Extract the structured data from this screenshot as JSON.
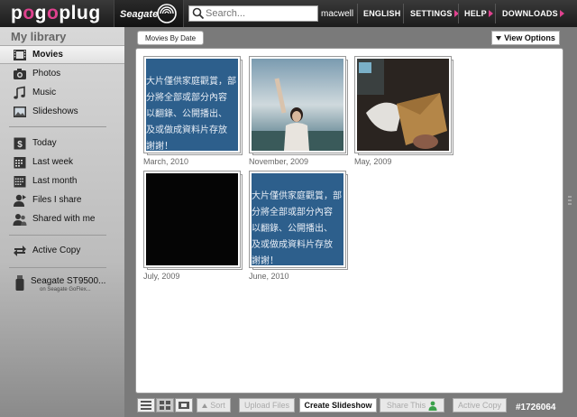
{
  "header": {
    "logo_text": "pogoplug",
    "brand": "Seagate",
    "search_placeholder": "Search...",
    "username": "macwell",
    "nav": [
      "ENGLISH",
      "SETTINGS",
      "HELP",
      "DOWNLOADS"
    ]
  },
  "sidebar": {
    "title": "My library",
    "media_items": [
      {
        "label": "Movies",
        "icon": "film-icon",
        "active": true
      },
      {
        "label": "Photos",
        "icon": "camera-icon",
        "active": false
      },
      {
        "label": "Music",
        "icon": "music-note-icon",
        "active": false
      },
      {
        "label": "Slideshows",
        "icon": "slideshow-icon",
        "active": false
      }
    ],
    "filter_items": [
      {
        "label": "Today",
        "icon": "calendar-today-icon"
      },
      {
        "label": "Last week",
        "icon": "calendar-week-icon"
      },
      {
        "label": "Last month",
        "icon": "calendar-month-icon"
      },
      {
        "label": "Files I share",
        "icon": "user-share-icon"
      },
      {
        "label": "Shared with me",
        "icon": "users-shared-icon"
      }
    ],
    "active_copy": {
      "label": "Active Copy",
      "icon": "swap-arrows-icon"
    },
    "device": {
      "name": "Seagate ST9500...",
      "sub": "on Seagate GoFlex...",
      "icon": "usb-drive-icon"
    }
  },
  "main": {
    "sort_label": "Movies By Date",
    "view_options_label": "View Options",
    "albums": [
      {
        "label": "March, 2010",
        "thumb": "blue-text"
      },
      {
        "label": "November, 2009",
        "thumb": "photo-woman"
      },
      {
        "label": "May, 2009",
        "thumb": "photo-envelope"
      },
      {
        "label": "July, 2009",
        "thumb": "black"
      },
      {
        "label": "June, 2010",
        "thumb": "blue-text"
      }
    ],
    "thumb_text_lines": [
      "大片僅供家庭觀賞，部",
      "分將全部或部分內容",
      "以翻錄、公開播出、",
      "及或做成資料片存放",
      "謝謝！"
    ]
  },
  "toolbar": {
    "sort": "Sort",
    "upload": "Upload Files",
    "create_slideshow": "Create Slideshow",
    "share_this": "Share This",
    "active_copy": "Active Copy"
  },
  "watermark": "#1726064",
  "colors": {
    "accent": "#e0428f",
    "thumb_blue": "#2d5f8c"
  }
}
